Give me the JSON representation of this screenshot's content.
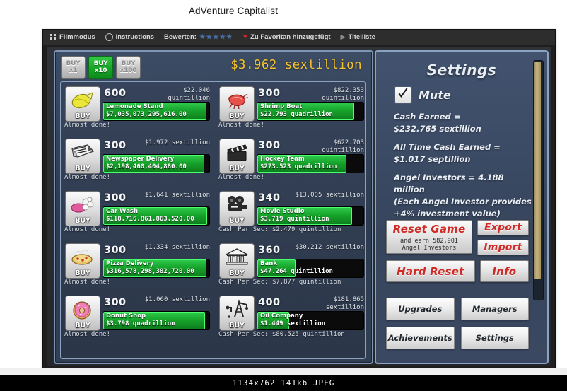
{
  "page": {
    "title": "AdVenture Capitalist"
  },
  "player_bar": {
    "filmmodus": "Filmmodus",
    "instructions": "Instructions",
    "rate_label": "Bewerten:",
    "stars": "★★★★★",
    "favorite": "Zu Favoritan hinzugefügt",
    "titleliste": "Titelliste"
  },
  "game": {
    "buy_multipliers": [
      {
        "l1": "BUY",
        "l2": "x1",
        "active": false
      },
      {
        "l1": "BUY",
        "l2": "x10",
        "active": true
      },
      {
        "l1": "BUY",
        "l2": "x100",
        "active": false
      }
    ],
    "cash_total": "$3.962 sextillion",
    "businesses_left": [
      {
        "icon": "lemon-icon",
        "buy": "BUY",
        "qty": "600",
        "price": "$22.046\nquintillion",
        "name": "Lemonade Stand",
        "value": "$7,035,073,295,616.00",
        "progress": 97,
        "status": "Almost done!"
      },
      {
        "icon": "newspaper-icon",
        "buy": "BUY",
        "qty": "300",
        "price": "$1.972 sextillion",
        "name": "Newspaper Delivery",
        "value": "$2,198,460,404,880.00",
        "progress": 95,
        "status": "Almost done!"
      },
      {
        "icon": "carwash-icon",
        "buy": "BUY",
        "qty": "300",
        "price": "$1.641 sextillion",
        "name": "Car Wash",
        "value": "$118,716,861,863,520.00",
        "progress": 98,
        "status": "Almost done!"
      },
      {
        "icon": "pizza-icon",
        "buy": "BUY",
        "qty": "300",
        "price": "$1.334 sextillion",
        "name": "Pizza Delivery",
        "value": "$316,578,298,302,720.00",
        "progress": 97,
        "status": "Almost done!"
      },
      {
        "icon": "donut-icon",
        "buy": "BUY",
        "qty": "300",
        "price": "$1.060 sextillion",
        "name": "Donut Shop",
        "value": "$3.798 quadrillion",
        "progress": 96,
        "status": "Almost done!"
      }
    ],
    "businesses_right": [
      {
        "icon": "shrimp-icon",
        "buy": "BUY",
        "qty": "300",
        "price": "$822.353\nquintillion",
        "name": "Shrimp Boat",
        "value": "$22.793 quadrillion",
        "progress": 91,
        "status": "Almost done!"
      },
      {
        "icon": "clapperboard-icon",
        "buy": "BUY",
        "qty": "300",
        "price": "$622.703\nquintillion",
        "name": "Hockey Team",
        "value": "$273.523 quadrillion",
        "progress": 84,
        "status": "Almost done!"
      },
      {
        "icon": "moviecamera-icon",
        "buy": "BUY",
        "qty": "340",
        "price": "$13.005 sextillion",
        "name": "Movie Studio",
        "value": "$3.719 quintillion",
        "progress": 89,
        "status": "Cash Per Sec: $2.479 quintillion"
      },
      {
        "icon": "bank-icon",
        "buy": "BUY",
        "qty": "360",
        "price": "$30.212 sextillion",
        "name": "Bank",
        "value": "$47.264 quintillion",
        "progress": 36,
        "status": "Cash Per Sec: $7.877 quintillion"
      },
      {
        "icon": "oilrig-icon",
        "buy": "BUY",
        "qty": "400",
        "price": "$181.865\nsextillion",
        "name": "Oil Company",
        "value": "$1.449 sextillion",
        "progress": 30,
        "status": "Cash Per Sec: $80.525 quintillion"
      }
    ]
  },
  "settings": {
    "title": "Settings",
    "mute_label": "Mute",
    "mute_checked": true,
    "stat_lines": [
      "Cash Earned =",
      "$232.765 sextillion",
      "",
      "All Time Cash Earned =",
      "$1.017 septillion",
      "",
      "Angel Investors = 4.188 million",
      "(Each Angel Investor provides",
      "+4% investment value)"
    ],
    "reset_game": {
      "main": "Reset Game",
      "sub": "and earn 582,901\nAngel Investors"
    },
    "export": "Export",
    "import": "Import",
    "hard_reset": "Hard Reset",
    "info": "Info",
    "nav": [
      "Upgrades",
      "Managers",
      "Achievements",
      "Settings"
    ]
  },
  "footer": {
    "info": "1134x762 141kb JPEG"
  },
  "colors": {
    "accent_cash": "#f2c230",
    "progress_green": "#17a42b",
    "panel_blue": "#36435a",
    "red_button_text": "#cf2a26",
    "scrollbar_gold": "#c9b781"
  }
}
